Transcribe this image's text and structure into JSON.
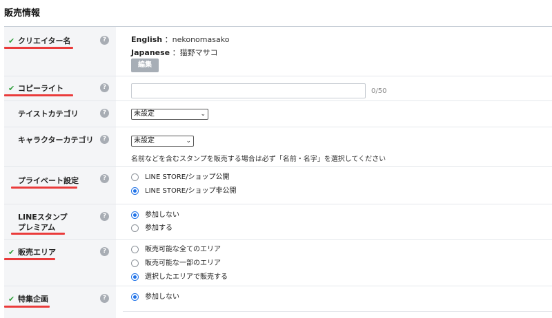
{
  "page_title": "販売情報",
  "creator": {
    "label": "クリエイター名",
    "english_key": "English",
    "english_value": "：nekonomasako",
    "japanese_key": "Japanese",
    "japanese_value": "：猫野マサコ",
    "edit_label": "編集"
  },
  "copyright": {
    "label": "コピーライト",
    "value": "",
    "counter": "0/50"
  },
  "taste_category": {
    "label": "テイストカテゴリ",
    "selected": "未設定"
  },
  "character_category": {
    "label": "キャラクターカテゴリ",
    "selected": "未設定",
    "note": "名前などを含むスタンプを販売する場合は必ず「名前・名字」を選択してください"
  },
  "private_setting": {
    "label": "プライベート設定",
    "options": [
      "LINE STORE/ショップ公開",
      "LINE STORE/ショップ非公開"
    ],
    "selected_index": 1
  },
  "premium": {
    "label_line1": "LINEスタンプ",
    "label_line2": "プレミアム",
    "options": [
      "参加しない",
      "参加する"
    ],
    "selected_index": 0
  },
  "sales_area": {
    "label": "販売エリア",
    "options": [
      "販売可能な全てのエリア",
      "販売可能な一部のエリア",
      "選択したエリアで販売する"
    ],
    "selected_index": 2
  },
  "special_campaign": {
    "label": "特集企画",
    "options": [
      "参加しない"
    ],
    "selected_index": 0
  },
  "help_glyph": "?",
  "check_glyph": "✔",
  "chevron_glyph": "⌄",
  "colors": {
    "accent_underline": "#ea3b3b",
    "check_green": "#2e9e3a",
    "radio_blue": "#1f72e8",
    "sidebar_bg": "#f4f5f7"
  }
}
